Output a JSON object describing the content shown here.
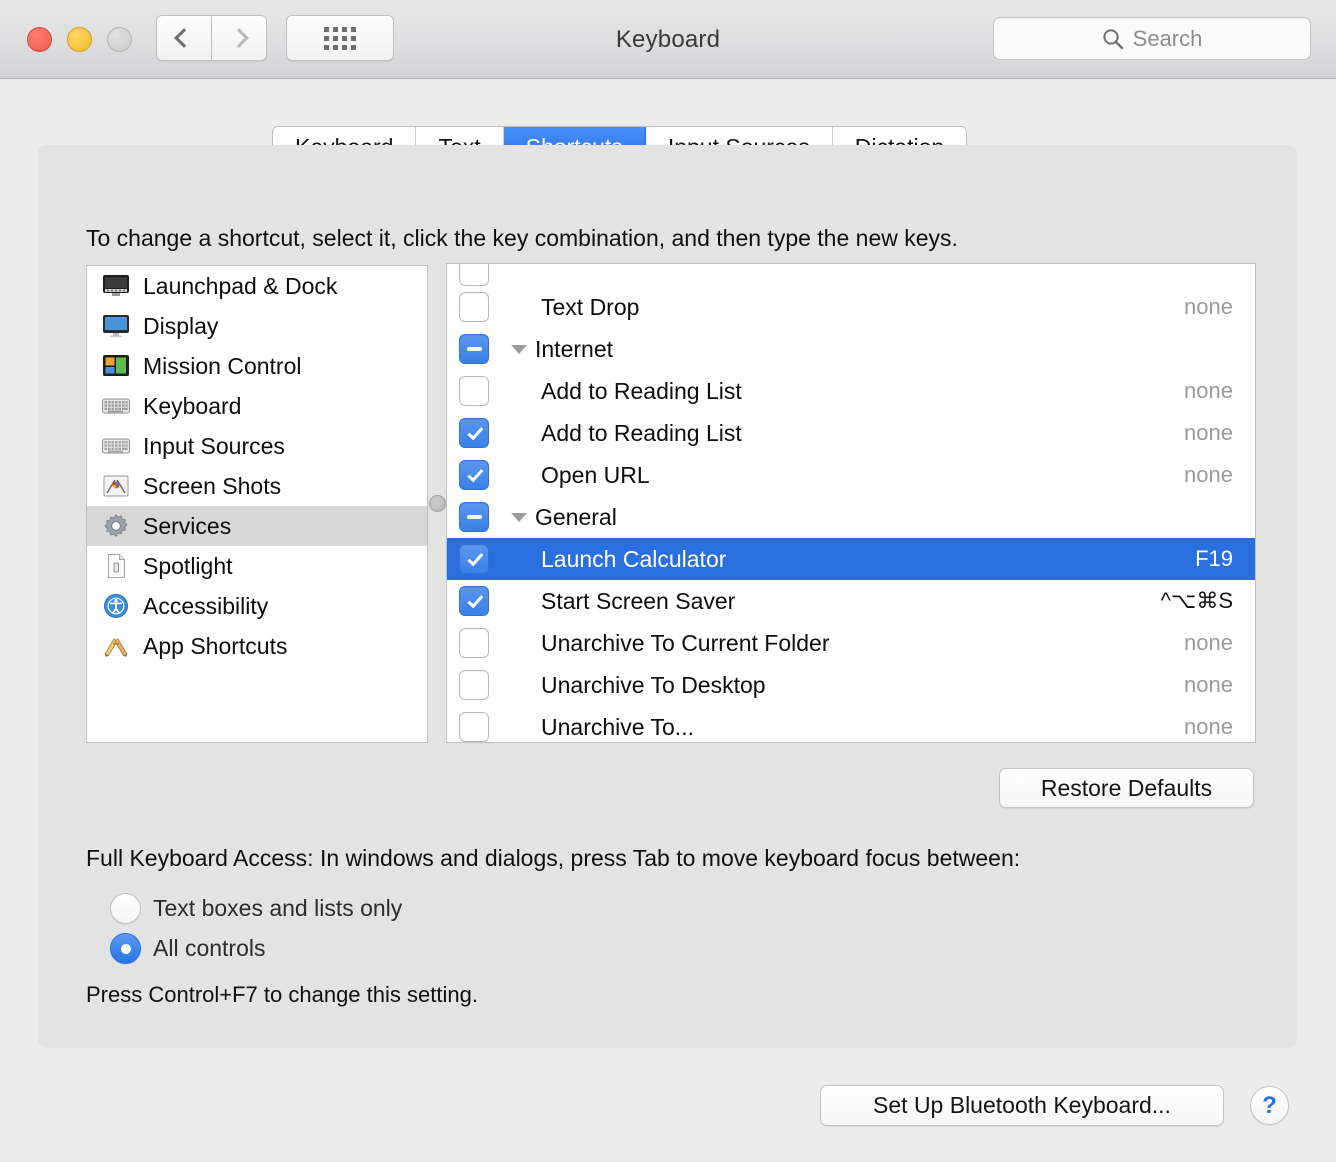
{
  "window": {
    "title": "Keyboard",
    "traffic_lights": [
      "close",
      "minimize",
      "zoom"
    ],
    "toolbar": {
      "back_icon": "chevron-left-icon",
      "forward_icon": "chevron-right-icon",
      "showall_icon": "grid-dots-icon"
    },
    "search": {
      "placeholder": "Search",
      "icon": "search-icon"
    }
  },
  "tabs": [
    {
      "label": "Keyboard",
      "active": false
    },
    {
      "label": "Text",
      "active": false
    },
    {
      "label": "Shortcuts",
      "active": true
    },
    {
      "label": "Input Sources",
      "active": false
    },
    {
      "label": "Dictation",
      "active": false
    }
  ],
  "instruction": "To change a shortcut, select it, click the key combination, and then type the new keys.",
  "sidebar": {
    "items": [
      {
        "label": "Launchpad & Dock",
        "icon": "launchpad-dock-icon",
        "selected": false
      },
      {
        "label": "Display",
        "icon": "display-icon",
        "selected": false
      },
      {
        "label": "Mission Control",
        "icon": "mission-control-icon",
        "selected": false
      },
      {
        "label": "Keyboard",
        "icon": "keyboard-icon",
        "selected": false
      },
      {
        "label": "Input Sources",
        "icon": "input-sources-icon",
        "selected": false
      },
      {
        "label": "Screen Shots",
        "icon": "screen-shots-icon",
        "selected": false
      },
      {
        "label": "Services",
        "icon": "services-gear-icon",
        "selected": true
      },
      {
        "label": "Spotlight",
        "icon": "spotlight-document-icon",
        "selected": false
      },
      {
        "label": "Accessibility",
        "icon": "accessibility-icon",
        "selected": false
      },
      {
        "label": "App Shortcuts",
        "icon": "app-shortcuts-icon",
        "selected": false
      }
    ]
  },
  "shortcut_list": {
    "rows": [
      {
        "kind": "item",
        "label": "",
        "shortcut": "",
        "checkbox": "unchecked",
        "selected": false,
        "partial": true
      },
      {
        "kind": "item",
        "label": "Text Drop",
        "shortcut": "none",
        "checkbox": "unchecked",
        "selected": false
      },
      {
        "kind": "group",
        "label": "Internet",
        "shortcut": "",
        "checkbox": "mixed",
        "selected": false
      },
      {
        "kind": "item",
        "label": "Add to Reading List",
        "shortcut": "none",
        "checkbox": "unchecked",
        "selected": false
      },
      {
        "kind": "item",
        "label": "Add to Reading List",
        "shortcut": "none",
        "checkbox": "checked",
        "selected": false
      },
      {
        "kind": "item",
        "label": "Open URL",
        "shortcut": "none",
        "checkbox": "checked",
        "selected": false
      },
      {
        "kind": "group",
        "label": "General",
        "shortcut": "",
        "checkbox": "mixed",
        "selected": false
      },
      {
        "kind": "item",
        "label": "Launch Calculator",
        "shortcut": "F19",
        "checkbox": "checked",
        "selected": true
      },
      {
        "kind": "item",
        "label": "Start Screen Saver",
        "shortcut": "^⌥⌘S",
        "checkbox": "checked",
        "selected": false
      },
      {
        "kind": "item",
        "label": "Unarchive To Current Folder",
        "shortcut": "none",
        "checkbox": "unchecked",
        "selected": false
      },
      {
        "kind": "item",
        "label": "Unarchive To Desktop",
        "shortcut": "none",
        "checkbox": "unchecked",
        "selected": false
      },
      {
        "kind": "item",
        "label": "Unarchive To...",
        "shortcut": "none",
        "checkbox": "unchecked",
        "selected": false
      }
    ]
  },
  "buttons": {
    "restore_defaults": "Restore Defaults",
    "set_up_bluetooth_keyboard": "Set Up Bluetooth Keyboard...",
    "help": "?"
  },
  "full_keyboard_access": {
    "label": "Full Keyboard Access: In windows and dialogs, press Tab to move keyboard focus between:",
    "options": [
      {
        "label": "Text boxes and lists only",
        "selected": false
      },
      {
        "label": "All controls",
        "selected": true
      }
    ],
    "hint": "Press Control+F7 to change this setting."
  },
  "colors": {
    "accent_blue": "#2b6fdf",
    "tab_active_blue": "#1f6fe8",
    "checkbox_blue": "#3a7fe8",
    "window_bg": "#ececec",
    "panel_bg": "#e3e3e3",
    "sidebar_selected": "#d7d7d7",
    "muted_text": "#9a9a9a"
  }
}
